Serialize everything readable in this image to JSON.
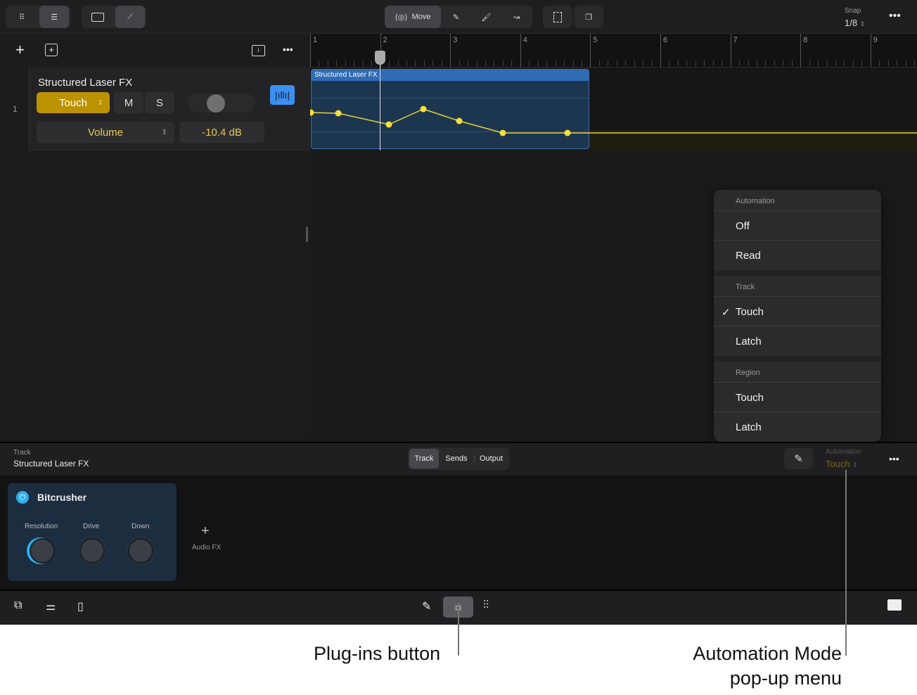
{
  "toolbar": {
    "move_label": "Move",
    "snap_label": "Snap",
    "snap_value": "1/8"
  },
  "ruler": {
    "bars": [
      "1",
      "2",
      "3",
      "4",
      "5",
      "6",
      "7",
      "8",
      "9"
    ]
  },
  "track": {
    "number": "1",
    "name": "Structured Laser FX",
    "automation_mode": "Touch",
    "mute": "M",
    "solo": "S",
    "parameter": "Volume",
    "value": "-10.4 dB"
  },
  "region": {
    "name": "Structured Laser FX"
  },
  "automation_menu": {
    "header": "Automation",
    "items": [
      "Off",
      "Read"
    ],
    "track_header": "Track",
    "track_items": [
      "Touch",
      "Latch"
    ],
    "track_checked": "Touch",
    "region_header": "Region",
    "region_items": [
      "Touch",
      "Latch"
    ]
  },
  "inspector": {
    "label": "Track",
    "track_name": "Structured Laser FX",
    "tabs": [
      "Track",
      "Sends",
      "Output"
    ],
    "active_tab": "Track",
    "automation_label": "Automation",
    "automation_value": "Touch"
  },
  "plugin": {
    "name": "Bitcrusher",
    "knobs": [
      "Resolution",
      "Drive",
      "Down"
    ],
    "add_label": "Audio FX"
  },
  "callouts": {
    "plugins": "Plug-ins button",
    "automation_line1": "Automation Mode",
    "automation_line2": "pop-up menu"
  },
  "colors": {
    "accent_yellow": "#c59b00",
    "region_blue": "#2f6cb5",
    "plugin_blue": "#2ab0f0"
  }
}
